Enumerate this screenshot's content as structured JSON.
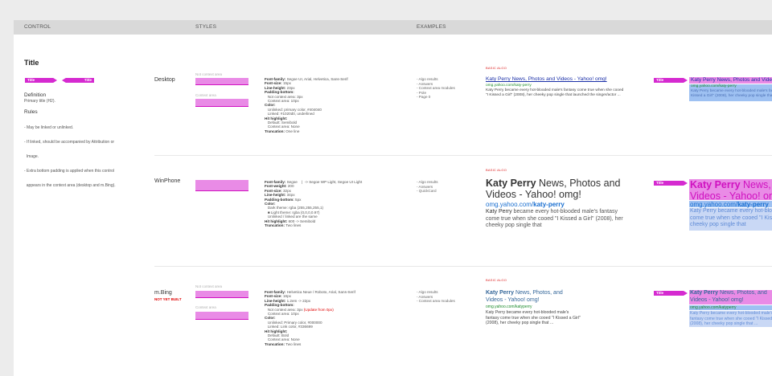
{
  "header": {
    "control": "CONTROL",
    "styles": "STYLES",
    "examples": "EXAMPLES"
  },
  "left": {
    "title": "Title",
    "badge": "Title",
    "definition_heading": "Definition",
    "definition_text": "Primary title (H2).",
    "rules_heading": "Rules",
    "rules": [
      "- May be linked or unlinked.",
      "- If linked, should be accompanied by Attribution or",
      "  Image.",
      "- Extra bottom padding is applied when this control",
      "  appears in the context area (desktop and m.Bing)."
    ]
  },
  "rows": [
    {
      "platform": "Desktop",
      "note": "",
      "cap1": "Not context area",
      "cap2": "Context area",
      "spec": [
        [
          "Font-family:",
          " Segoe UI, Arial, Helvetica, Sans-Serif"
        ],
        [
          "Font-size:",
          " 15px"
        ],
        [
          "Line-height:",
          " 23px"
        ],
        [
          "Padding-bottom:",
          ""
        ],
        [
          "",
          " Not context area: 3px"
        ],
        [
          "",
          " Context area: 10px"
        ],
        [
          "Color:",
          ""
        ],
        [
          "",
          " Unlinked: primary color, #404040"
        ],
        [
          "",
          " Linked: #1020d0, underlined"
        ],
        [
          "Hit highlight:",
          ""
        ],
        [
          "",
          " Default: Semibold"
        ],
        [
          "",
          " Context area: None"
        ],
        [
          "Truncation:",
          " One line"
        ]
      ],
      "examples": [
        "- Algo results",
        "- Answers",
        "- Context area modules",
        "- Pole",
        "- Page 0"
      ],
      "basic": "BASIC ALGO",
      "res_title": "Katy Perry News, Photos and Videos - Yahoo! omg!",
      "res_url": "omg.yahoo.com/katy-perry",
      "res_snip": "Katy Perry became every hot-blooded male's fantasy come true when she cooed \"I Kissed a Girl\" (2008), her cheeky pop single that launched the singer/actor ..."
    },
    {
      "platform": "WinPhone",
      "note": "",
      "spec": [
        [
          "Font-family:",
          " Segoe    |  -> Segoe WP Light, Segoe UI Light"
        ],
        [
          "Font-weight:",
          " 200"
        ],
        [
          "Font-size:",
          " 32px"
        ],
        [
          "Line-height:",
          " 34px"
        ],
        [
          "Padding-bottom:",
          " 5px"
        ],
        [
          "Color:",
          ""
        ],
        [
          "",
          " Dark theme: rgba (255,255,255,1)"
        ],
        [
          "",
          " ■ Light theme: rgba (0,0,0,0.97)"
        ],
        [
          "",
          " Unlinked / linked are the same"
        ],
        [
          "Hit highlight:",
          " 600 -> Semibold"
        ],
        [
          "Truncation:",
          " Two lines"
        ]
      ],
      "examples": [
        "- Algo results",
        "- Answers",
        "- QuickCard"
      ],
      "basic": "BASIC ALGO",
      "res_title_bold": "Katy Perry",
      "res_title_rest": " News, Photos and Videos - Yahoo! omg!",
      "res_url": "omg.yahoo.com/",
      "res_url_bold": "katy-perry",
      "res_snip_bold": "Katy Perry",
      "res_snip": " became every hot-blooded male's fantasy come true when she cooed \"I Kissed a Girl\" (2008), her cheeky pop single that"
    },
    {
      "platform": "m.Bing",
      "note": "NOT YET BUILT",
      "cap1": "Not context area",
      "cap2": "Context area",
      "spec": [
        [
          "Font-family:",
          " Helvetica Neue / Roboto, Arial, Sans-Serif"
        ],
        [
          "Font-size:",
          " 16px"
        ],
        [
          "Line-height:",
          " 1.2em -> 22px"
        ],
        [
          "Padding-bottom:",
          ""
        ],
        [
          "",
          " Not context area: 3px (Update from 0px)"
        ],
        [
          "",
          " Context area: 10px"
        ],
        [
          "Color:",
          ""
        ],
        [
          "",
          " Unlinked: Primary color, #000000"
        ],
        [
          "",
          " Linked: Link color, #336699"
        ],
        [
          "Hit highlight:",
          ""
        ],
        [
          "",
          " Default: Bold"
        ],
        [
          "",
          " Context area: None"
        ],
        [
          "Truncation:",
          " Two lines"
        ]
      ],
      "examples": [
        "- Algo results",
        "- Answers",
        "- Context area modules"
      ],
      "basic": "BASIC ALGO",
      "res_title_bold": "Katy Perry",
      "res_title_rest": " News, Photos, and Videos - Yahoo! omg!",
      "res_url": "omg.yahoo.com/",
      "res_url_bold": "katyperry",
      "res_snip": "Katy Perry became every hot-blooded male's fantasy come true when she cooed \"I Kissed a Girl\" (2008), her cheeky pop single that ..."
    }
  ],
  "overlay_badge": "Title",
  "colors": {
    "accent": "#d52ad0",
    "pink": "#e98be6",
    "link": "#1a2fa8",
    "url": "#1a8a2a",
    "red": "#e00000"
  }
}
